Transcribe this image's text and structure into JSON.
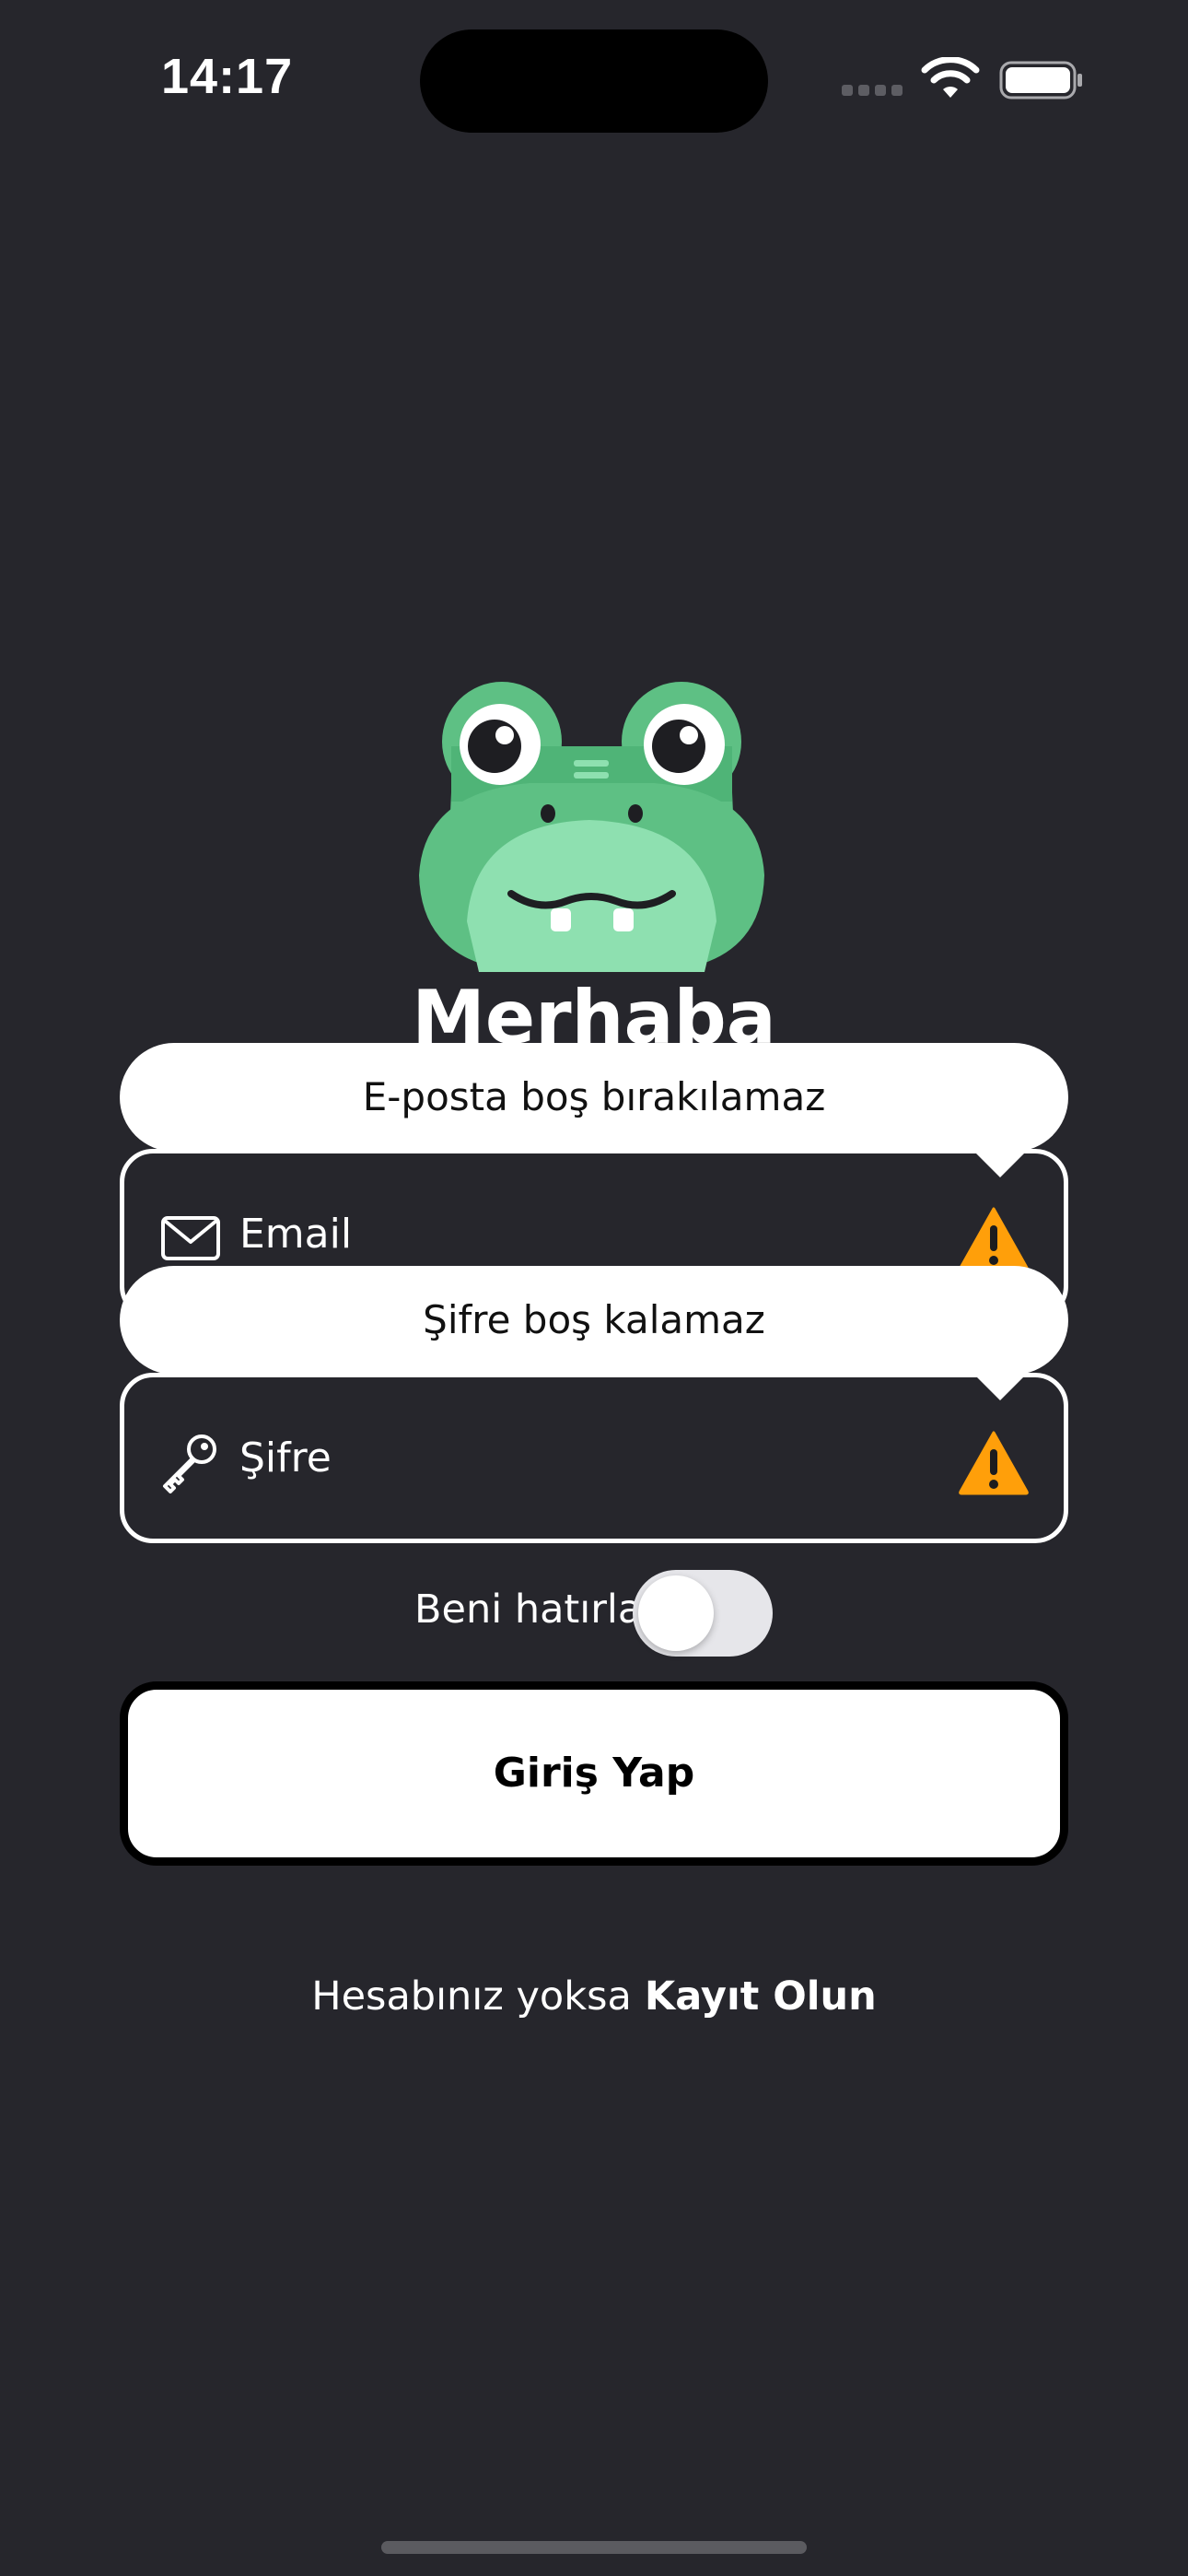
{
  "status_bar": {
    "time": "14:17"
  },
  "welcome": {
    "title": "Merhaba"
  },
  "email_field": {
    "placeholder": "Email",
    "error_tooltip": "E-posta boş bırakılamaz"
  },
  "password_field": {
    "placeholder": "Şifre",
    "error_tooltip": "Şifre boş kalamaz"
  },
  "remember_me": {
    "label": "Beni hatırla",
    "enabled": false
  },
  "login_button": {
    "label": "Giriş Yap"
  },
  "register": {
    "prompt": "Hesabınız yoksa",
    "link_label": "Kayıt Olun"
  },
  "colors": {
    "background": "#26262c",
    "warning": "#ff9f0a",
    "logo_green": "#5ec084",
    "logo_light_green": "#8ee0b0"
  },
  "icons": {
    "email": "envelope-icon",
    "password": "key-icon",
    "warning": "warning-triangle-icon"
  }
}
